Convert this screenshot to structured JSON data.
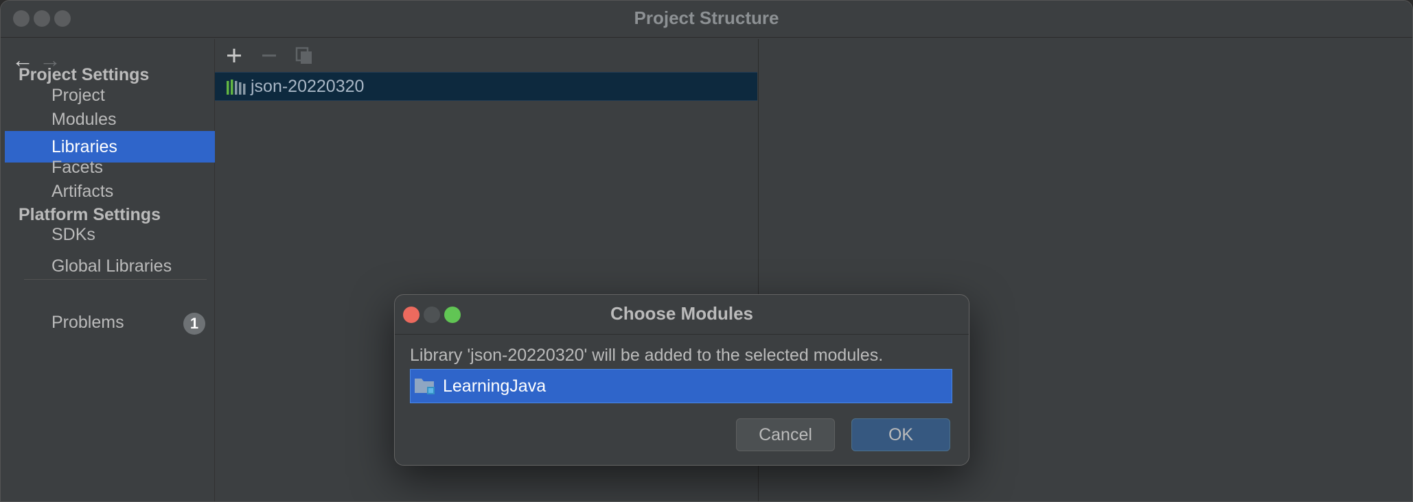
{
  "window": {
    "title": "Project Structure"
  },
  "nav": {
    "back": "←",
    "forward": "→"
  },
  "sidebar": {
    "project_settings_heading": "Project Settings",
    "project_items": [
      "Project",
      "Modules",
      "Libraries",
      "Facets",
      "Artifacts"
    ],
    "selected_item": "Libraries",
    "platform_settings_heading": "Platform Settings",
    "platform_items": [
      "SDKs",
      "Global Libraries"
    ],
    "problems": {
      "label": "Problems",
      "count": "1"
    }
  },
  "libraries_toolbar": {
    "add": "+",
    "remove": "−"
  },
  "libraries": [
    {
      "name": "json-20220320"
    }
  ],
  "dialog": {
    "title": "Choose Modules",
    "message": "Library 'json-20220320' will be added to the selected modules.",
    "modules": [
      {
        "name": "LearningJava"
      }
    ],
    "cancel_label": "Cancel",
    "ok_label": "OK"
  },
  "colors": {
    "background": "#3c3f41",
    "selection": "#2f65ca",
    "library_row": "#0d293e",
    "close": "#ec6a5e",
    "minimize": "#4e5254",
    "maximize": "#61c554"
  }
}
